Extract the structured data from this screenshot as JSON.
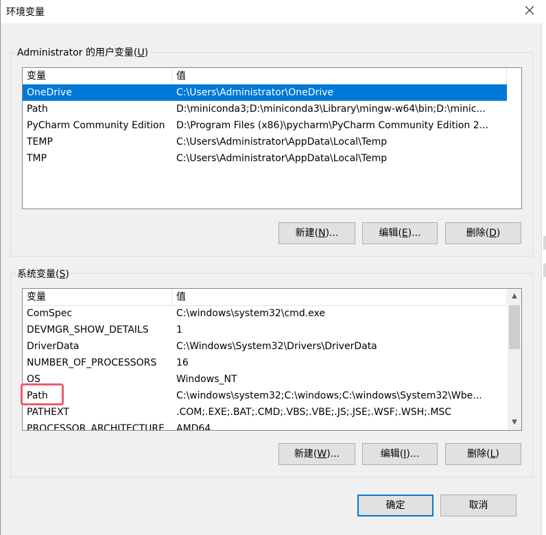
{
  "window": {
    "title": "环境变量"
  },
  "user_vars": {
    "group_label_prefix": "Administrator 的用户变量(",
    "group_label_key": "U",
    "group_label_suffix": ")",
    "headers": {
      "name": "变量",
      "value": "值"
    },
    "rows": [
      {
        "name": "OneDrive",
        "value": "C:\\Users\\Administrator\\OneDrive",
        "selected": true
      },
      {
        "name": "Path",
        "value": "D:\\miniconda3;D:\\miniconda3\\Library\\mingw-w64\\bin;D:\\minic..."
      },
      {
        "name": "PyCharm Community Edition",
        "value": "D:\\Program Files (x86)\\pycharm\\PyCharm Community Edition 2..."
      },
      {
        "name": "TEMP",
        "value": "C:\\Users\\Administrator\\AppData\\Local\\Temp"
      },
      {
        "name": "TMP",
        "value": "C:\\Users\\Administrator\\AppData\\Local\\Temp"
      }
    ],
    "buttons": {
      "new": {
        "pre": "新建(",
        "key": "N",
        "post": ")..."
      },
      "edit": {
        "pre": "编辑(",
        "key": "E",
        "post": ")..."
      },
      "delete": {
        "pre": "删除(",
        "key": "D",
        "post": ")"
      }
    }
  },
  "system_vars": {
    "group_label_prefix": "系统变量(",
    "group_label_key": "S",
    "group_label_suffix": ")",
    "headers": {
      "name": "变量",
      "value": "值"
    },
    "rows": [
      {
        "name": "ComSpec",
        "value": "C:\\windows\\system32\\cmd.exe"
      },
      {
        "name": "DEVMGR_SHOW_DETAILS",
        "value": "1"
      },
      {
        "name": "DriverData",
        "value": "C:\\Windows\\System32\\Drivers\\DriverData"
      },
      {
        "name": "NUMBER_OF_PROCESSORS",
        "value": "16"
      },
      {
        "name": "OS",
        "value": "Windows_NT"
      },
      {
        "name": "Path",
        "value": "C:\\windows\\system32;C:\\windows;C:\\windows\\System32\\Wbe...",
        "highlighted": true
      },
      {
        "name": "PATHEXT",
        "value": ".COM;.EXE;.BAT;.CMD;.VBS;.VBE;.JS;.JSE;.WSF;.WSH;.MSC"
      },
      {
        "name": "PROCESSOR_ARCHITECTURE",
        "value": "AMD64"
      }
    ],
    "buttons": {
      "new": {
        "pre": "新建(",
        "key": "W",
        "post": ")..."
      },
      "edit": {
        "pre": "编辑(",
        "key": "I",
        "post": ")..."
      },
      "delete": {
        "pre": "删除(",
        "key": "L",
        "post": ")"
      }
    }
  },
  "footer": {
    "ok": "确定",
    "cancel": "取消"
  },
  "colors": {
    "selection": "#0078d7",
    "highlight_box": "#f05a6e"
  }
}
